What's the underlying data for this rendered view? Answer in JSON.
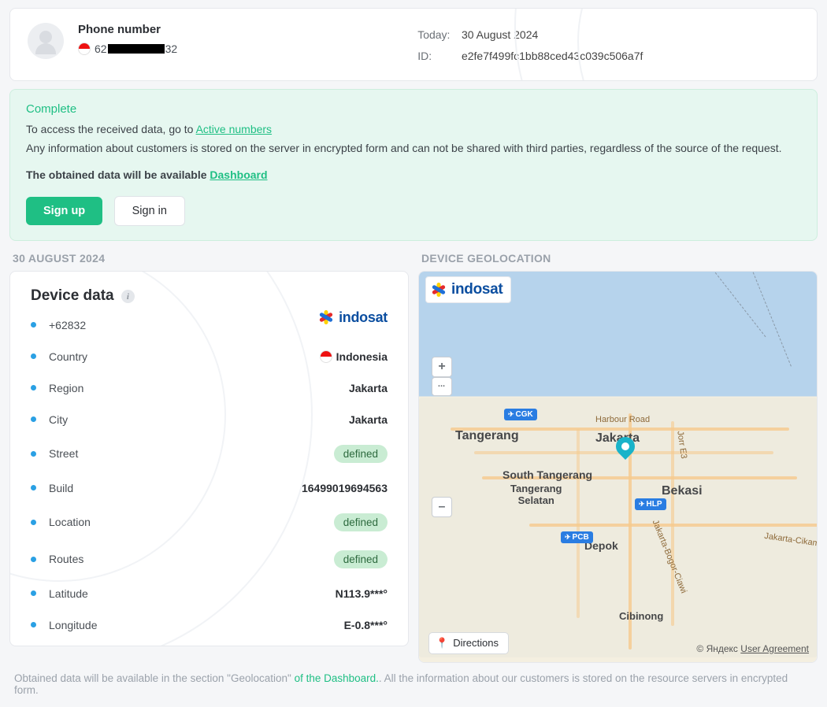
{
  "header": {
    "title": "Phone number",
    "phone_prefix": "62",
    "phone_suffix": "32",
    "today_label": "Today:",
    "today_value": "30 August 2024",
    "id_label": "ID:",
    "id_value": "e2fe7f499fc1bb88ced43c039c506a7f"
  },
  "notice": {
    "title": "Complete",
    "line1_pre": "To access the received data, go to ",
    "line1_link": "Active numbers",
    "line2": "Any information about customers is stored on the server in encrypted form and can not be shared with third parties, regardless of the source of the request.",
    "line3_pre": "The obtained data will be available ",
    "line3_link": "Dashboard",
    "signup": "Sign up",
    "signin": "Sign in"
  },
  "section_date": "30 AUGUST 2024",
  "section_geo": "DEVICE GEOLOCATION",
  "device": {
    "title": "Device data",
    "carrier": "indosat",
    "rows": [
      {
        "label_pre": "+628",
        "label_suf": "32",
        "value_type": "carrier",
        "value": "indosat"
      },
      {
        "label": "Country",
        "value_type": "flag_text",
        "value": "Indonesia"
      },
      {
        "label": "Region",
        "value_type": "text",
        "value": "Jakarta"
      },
      {
        "label": "City",
        "value_type": "text",
        "value": "Jakarta"
      },
      {
        "label": "Street",
        "value_type": "badge",
        "value": "defined"
      },
      {
        "label": "Build",
        "value_type": "text",
        "value": "16499019694563"
      },
      {
        "label": "Location",
        "value_type": "badge",
        "value": "defined"
      },
      {
        "label": "Routes",
        "value_type": "badge",
        "value": "defined"
      },
      {
        "label": "Latitude",
        "value_type": "text",
        "value": "N113.9***°"
      },
      {
        "label": "Longitude",
        "value_type": "text",
        "value": "E-0.8***°"
      }
    ]
  },
  "map": {
    "carrier": "indosat",
    "labels": {
      "tangerang": "Tangerang",
      "south_tangerang": "South Tangerang",
      "tangerang_selatan": "Tangerang\nSelatan",
      "jakarta": "Jakarta",
      "bekasi": "Bekasi",
      "depok": "Depok",
      "cibinong": "Cibinong",
      "harbour_road": "Harbour Road",
      "jkt_cikampek": "Jakarta-Cikampek",
      "jorr_e3": "Jorr E3",
      "jkt_bogor": "Jakarta-Bogor-Ciawi"
    },
    "airports": {
      "cgk": "CGK",
      "hlp": "HLP",
      "pcb": "PCB"
    },
    "directions": "Directions",
    "attrib_pre": "© Яндекс ",
    "attrib_link": "User Agreement"
  },
  "footer": {
    "pre": "Obtained data will be available in the section \"Geolocation\" ",
    "link": "of the Dashboard.",
    "post": ". All the information about our customers is stored on the resource servers in encrypted form."
  }
}
